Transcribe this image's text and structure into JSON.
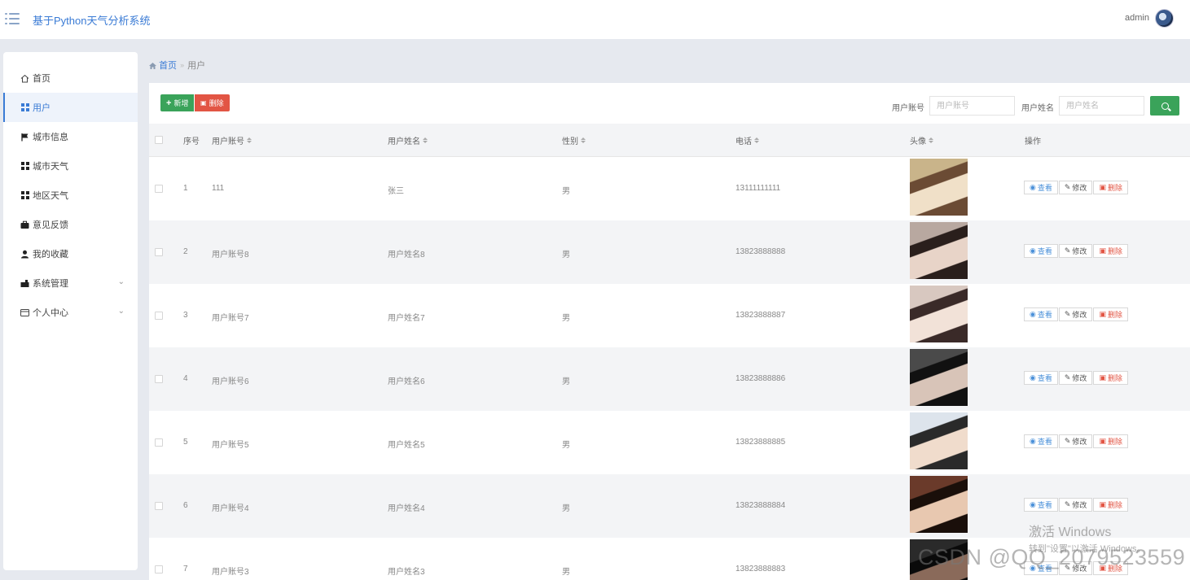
{
  "header": {
    "app_title": "基于Python天气分析系统",
    "user": "admin"
  },
  "sidebar": {
    "items": [
      {
        "label": "首页",
        "icon": "home-icon"
      },
      {
        "label": "用户",
        "icon": "grid-icon",
        "active": true
      },
      {
        "label": "城市信息",
        "icon": "flag-icon"
      },
      {
        "label": "城市天气",
        "icon": "grid-icon"
      },
      {
        "label": "地区天气",
        "icon": "grid-icon"
      },
      {
        "label": "意见反馈",
        "icon": "briefcase-icon"
      },
      {
        "label": "我的收藏",
        "icon": "user-icon"
      },
      {
        "label": "系统管理",
        "icon": "toolbox-icon",
        "expandable": true
      },
      {
        "label": "个人中心",
        "icon": "card-icon",
        "expandable": true
      }
    ]
  },
  "breadcrumb": {
    "home": "首页",
    "current": "用户"
  },
  "toolbar": {
    "add_label": "新增",
    "delete_label": "删除"
  },
  "search": {
    "account_label": "用户账号",
    "account_placeholder": "用户账号",
    "name_label": "用户姓名",
    "name_placeholder": "用户姓名"
  },
  "table": {
    "columns": [
      "序号",
      "用户账号",
      "用户姓名",
      "性别",
      "电话",
      "头像",
      "操作"
    ],
    "rows": [
      {
        "index": "1",
        "account": "111",
        "name": "张三",
        "gender": "男",
        "phone": "13111111111"
      },
      {
        "index": "2",
        "account": "用户账号8",
        "name": "用户姓名8",
        "gender": "男",
        "phone": "13823888888"
      },
      {
        "index": "3",
        "account": "用户账号7",
        "name": "用户姓名7",
        "gender": "男",
        "phone": "13823888887"
      },
      {
        "index": "4",
        "account": "用户账号6",
        "name": "用户姓名6",
        "gender": "男",
        "phone": "13823888886"
      },
      {
        "index": "5",
        "account": "用户账号5",
        "name": "用户姓名5",
        "gender": "男",
        "phone": "13823888885"
      },
      {
        "index": "6",
        "account": "用户账号4",
        "name": "用户姓名4",
        "gender": "男",
        "phone": "13823888884"
      },
      {
        "index": "7",
        "account": "用户账号3",
        "name": "用户姓名3",
        "gender": "男",
        "phone": "13823888883"
      }
    ],
    "actions": {
      "view": "查看",
      "edit": "修改",
      "delete": "删除"
    }
  },
  "watermarks": {
    "windows_line1": "激活 Windows",
    "windows_line2": "转到\"设置\"以激活 Windows。",
    "csdn": "CSDN @QQ_2079523559"
  },
  "colors": {
    "accent": "#3a7bd5",
    "success": "#3aa35a",
    "danger": "#e25544"
  }
}
